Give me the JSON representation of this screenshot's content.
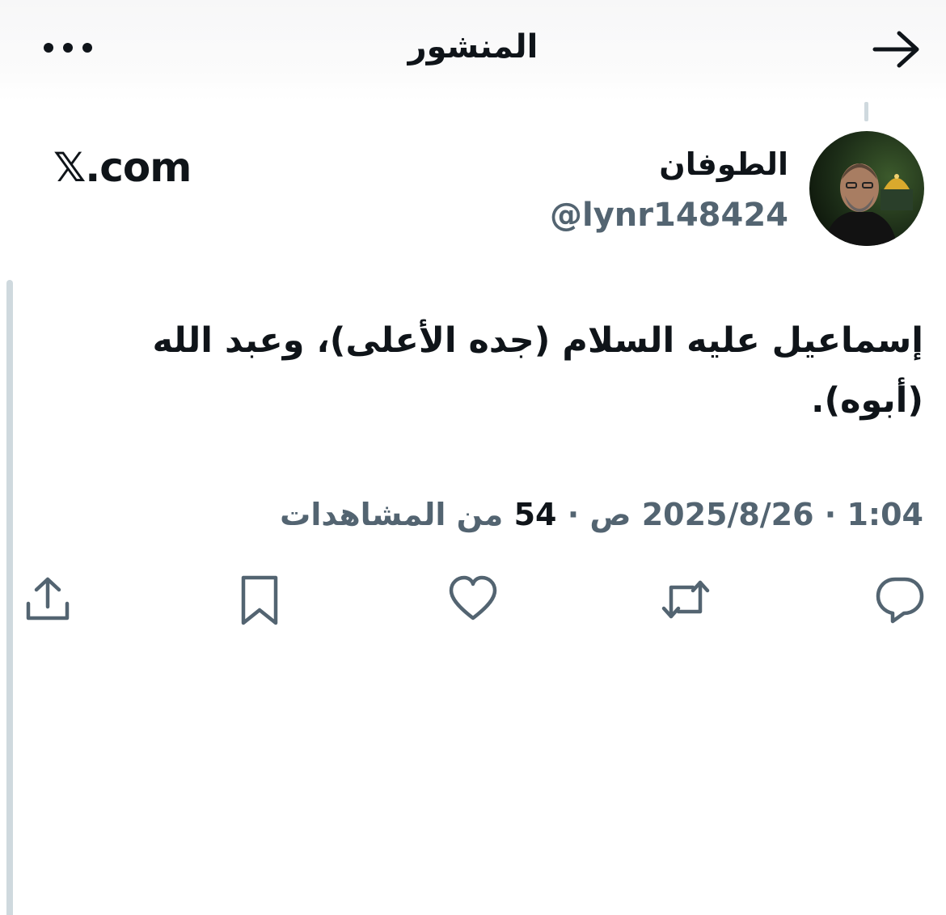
{
  "header": {
    "title": "المنشور"
  },
  "author": {
    "display_name": "الطوفان",
    "handle": "@lynr148424",
    "source": "𝕏.com"
  },
  "tweet": {
    "text": "إسماعيل عليه السلام (جده الأعلى)، وعبد الله (أبوه)."
  },
  "meta": {
    "date": "2025/8/26",
    "time": "1:04 ص",
    "separator": "·",
    "views_count": "54",
    "views_label": "من المشاهدات"
  },
  "colors": {
    "text_primary": "#0f1419",
    "text_secondary": "#536471",
    "thread_line": "#cfd9de"
  },
  "icons": {
    "back": "arrow-right-icon",
    "more": "more-horizontal-icon",
    "reply": "reply-icon",
    "retweet": "retweet-icon",
    "like": "heart-icon",
    "bookmark": "bookmark-icon",
    "share": "share-icon"
  }
}
